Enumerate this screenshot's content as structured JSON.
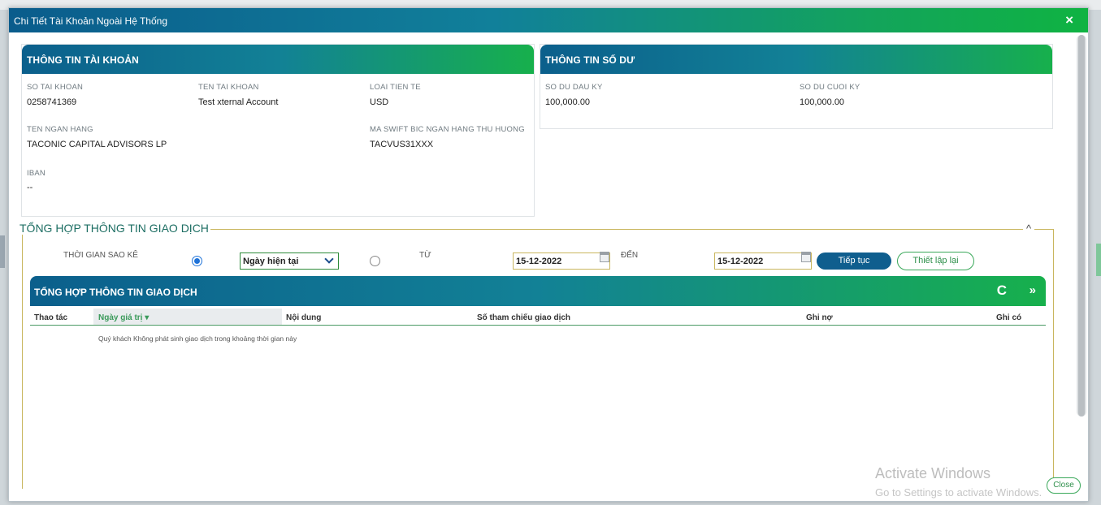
{
  "dialog": {
    "title": "Chi Tiết Tài Khoản Ngoài Hệ Thống",
    "close_symbol": "×",
    "close_button_label": "Close"
  },
  "account_info": {
    "heading": "THÔNG TIN TÀI KHOẢN",
    "account_number_label": "SO TAI KHOAN",
    "account_number": "0258741369",
    "account_name_label": "TEN TAI KHOAN",
    "account_name": "Test xternal Account",
    "currency_label": "LOAI TIEN TE",
    "currency": "USD",
    "bank_name_label": "TEN NGAN HANG",
    "bank_name": "TACONIC CAPITAL ADVISORS LP",
    "swift_label": "MA SWIFT BIC NGAN HANG THU HUONG",
    "swift": "TACVUS31XXX",
    "iban_label": "IBAN",
    "iban": "--"
  },
  "balance_info": {
    "heading": "THÔNG TIN SỐ DƯ",
    "opening_label": "SO DU DAU KY",
    "opening": "100,000.00",
    "closing_label": "SO DU CUOI KY",
    "closing": "100,000.00"
  },
  "transactions": {
    "section_title": "TỔNG HỢP THÔNG TIN GIAO DỊCH",
    "collapse_symbol": "^",
    "filter": {
      "period_label": "THỜI GIAN SAO KÊ",
      "period_selected": "Ngày hiện tại",
      "from_label": "TỪ",
      "from_date": "15-12-2022",
      "to_label": "ĐẾN",
      "to_date": "15-12-2022",
      "continue_label": "Tiếp tục",
      "reset_label": "Thiết lập lại"
    },
    "grid": {
      "title": "TỔNG HỢP THÔNG TIN GIAO DỊCH",
      "refresh_symbol": "C",
      "expand_symbol": "»",
      "columns": [
        "Thao tác",
        "Ngày giá trị ▾",
        "Nội dung",
        "Số tham chiếu giao dịch",
        "Ghi nợ",
        "Ghi có"
      ],
      "empty_message": "Quý khách Không phát sinh giao dịch trong khoảng thời gian này"
    }
  },
  "watermark": {
    "line1": "Activate Windows",
    "line2": "Go to Settings to activate Windows."
  },
  "colors": {
    "accent_blue": "#0f5e8e",
    "accent_green": "#17b04c",
    "border_gold": "#c9b65e"
  }
}
